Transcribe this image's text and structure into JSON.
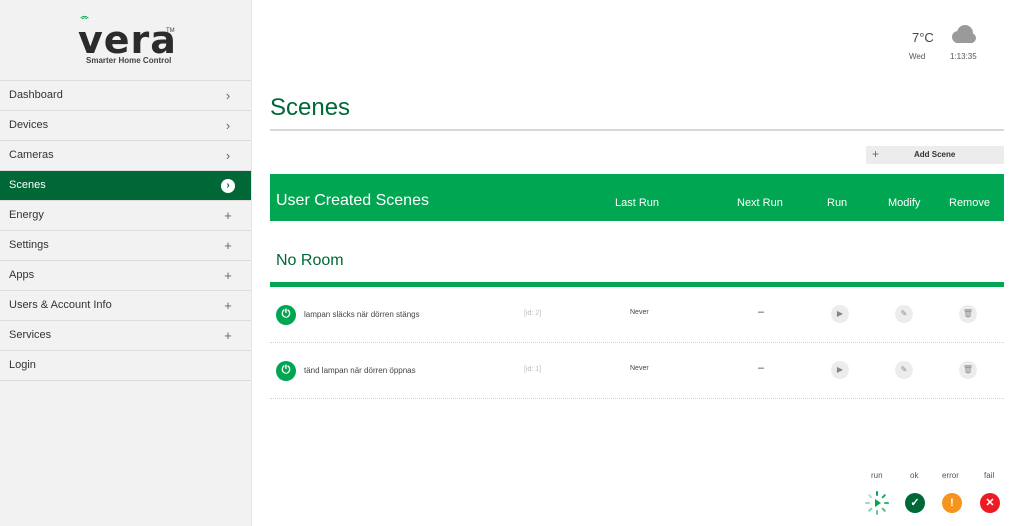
{
  "logo": {
    "text": "vera",
    "tagline": "Smarter Home Control",
    "tm": "TM"
  },
  "sidebar": {
    "items": [
      {
        "label": "Dashboard",
        "indicator": "›"
      },
      {
        "label": "Devices",
        "indicator": "›"
      },
      {
        "label": "Cameras",
        "indicator": "›"
      },
      {
        "label": "Scenes",
        "indicator": "›",
        "active": true
      },
      {
        "label": "Energy",
        "indicator": "+"
      },
      {
        "label": "Settings",
        "indicator": "+"
      },
      {
        "label": "Apps",
        "indicator": "+"
      },
      {
        "label": "Users & Account Info",
        "indicator": "+"
      },
      {
        "label": "Services",
        "indicator": "+"
      },
      {
        "label": "Login",
        "indicator": ""
      }
    ]
  },
  "weather": {
    "temperature": "7°C",
    "day": "Wed",
    "time": "1:13:35",
    "icon": "cloud-icon"
  },
  "page": {
    "title": "Scenes",
    "add_scene_label": "Add Scene"
  },
  "table": {
    "title": "User Created Scenes",
    "columns": [
      "Last Run",
      "Next Run",
      "Run",
      "Modify",
      "Remove"
    ]
  },
  "room": {
    "name": "No Room"
  },
  "scenes": [
    {
      "name": "lampan släcks när dörren stängs",
      "id": "[id: 2]",
      "last_run": "Never",
      "next_run": "–"
    },
    {
      "name": "tänd lampan när dörren öppnas",
      "id": "[id: 1]",
      "last_run": "Never",
      "next_run": "–"
    }
  ],
  "legend": {
    "run": "run",
    "ok": "ok",
    "error": "error",
    "fail": "fail"
  },
  "colors": {
    "primary": "#00a651",
    "dark": "#006837",
    "error": "#f7941d",
    "fail": "#ed1c24"
  }
}
